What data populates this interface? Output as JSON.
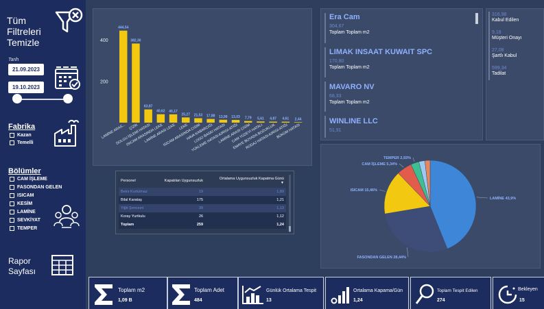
{
  "sidebar": {
    "clear_filters": "Tüm Filtreleri Temizle",
    "date_label": "Tarih",
    "date_start": "21.09.2023",
    "date_end": "19.10.2023",
    "factory_title": "Fabrika",
    "factories": [
      "Kazan",
      "Temelli"
    ],
    "departments_title": "Bölümler",
    "departments": [
      "CAM İŞLEME",
      "FASONDAN GELEN",
      "ISICAM",
      "KESİM",
      "LAMİNE",
      "SEVKİYAT",
      "TEMPER"
    ],
    "report_page": "Rapor Sayfası"
  },
  "chart_data": [
    {
      "type": "bar",
      "categories": [
        "LAMİNE ARAS...",
        "ÇİZİK",
        "DOLGU İŞLEMİ HATASI",
        "ISICAM ARASINDA LEKE",
        "LAMİNE ARASI LEKE",
        "LEKE",
        "ISICAM ARASINDA CISIM",
        "HAVA KABARCIĞI",
        "LOGO BASKI HATASI",
        "YÜKLEME HATASI-KIRIGI-ATIĞI",
        "LAMİNE ARASI CİSİM",
        "CAM YÜZEYİ HATALI",
        "EMAYE BOYADA BOZUKLUK",
        "RODAJ HATASI-KIRIGI-ATIĞI",
        "BÜKÜM HATASI"
      ],
      "values": [
        444.54,
        382.3,
        63.87,
        40.62,
        40.17,
        25.27,
        21.53,
        17.88,
        13.99,
        13.03,
        7.79,
        5.61,
        4.87,
        4.61,
        2.44
      ],
      "value_labels": [
        "444,54",
        "382,30",
        "63,87",
        "40,62",
        "40,17",
        "25,27",
        "21,53",
        "17,88",
        "13,99",
        "13,03",
        "7,79",
        "5,61",
        "4,87",
        "4,61",
        "2,44"
      ],
      "yticks": [
        "200",
        "400"
      ],
      "ylim": [
        0,
        480
      ],
      "color": "#f2c811"
    },
    {
      "type": "pie",
      "labels": [
        "LAMİNE",
        "FASONDAN GELEN",
        "ISICAM",
        "CAM İŞLEME",
        "TEMPER",
        "Other1",
        "Other2"
      ],
      "values": [
        43.9,
        28.44,
        15.46,
        5.34,
        2.93,
        2.1,
        1.83
      ],
      "visible_labels": [
        "LAMİNE 43,9%",
        "FASONDAN GELEN 28,44%",
        "ISICAM 15,46%",
        "CAM İŞLEME 5,34%",
        "TEMPER 2,93%"
      ],
      "colors": [
        "#3e86d8",
        "#3d4d78",
        "#f2c811",
        "#e25c4b",
        "#3fbf8f",
        "#9cc9f0",
        "#e8875a"
      ]
    }
  ],
  "companies": [
    {
      "name": "Era Cam",
      "value": "304,67",
      "sub": "Toplam Toplam m2"
    },
    {
      "name": "LIMAK INSAAT KUWAIT SPC",
      "value": "170,80",
      "sub": "Toplam Toplam m2"
    },
    {
      "name": "MAVARO NV",
      "value": "68,33",
      "sub": "Toplam Toplam m2"
    },
    {
      "name": "WINLINE LLC",
      "value": "51,91",
      "sub": ""
    }
  ],
  "metrics": [
    {
      "value": "316,98",
      "label": "Kabul Edilen"
    },
    {
      "value": "9,18",
      "label": "Müşteri Onayı"
    },
    {
      "value": "27,08",
      "label": "Şartlı Kabul"
    },
    {
      "value": "599,34",
      "label": "Tadilat"
    }
  ],
  "table": {
    "headers": [
      "Personel",
      "Kapatılan Uygunsuzluk",
      "Ortalama Uygunsuzluk Kapatma Günü"
    ],
    "rows": [
      [
        "Bekir Kurtulmaz",
        "19",
        "1,89"
      ],
      [
        "Bilal Karataş",
        "175",
        "1,21"
      ],
      [
        "Yiğit Şencezri",
        "39",
        "1,13"
      ],
      [
        "Koray Yurtkulu",
        "26",
        "1,12"
      ]
    ],
    "total": [
      "Toplam",
      "259",
      "1,24"
    ]
  },
  "kpis": [
    {
      "title": "Toplam m2",
      "value": "1,09 B"
    },
    {
      "title": "Toplam Adet",
      "value": "484"
    },
    {
      "title": "Günlük Ortalama Tespit",
      "value": "13"
    },
    {
      "title": "Ortalama Kapama/Gün",
      "value": "1,24"
    },
    {
      "title": "Toplam Tespit Edilen",
      "value": "274"
    },
    {
      "title": "Bekleyen",
      "value": "15"
    }
  ]
}
